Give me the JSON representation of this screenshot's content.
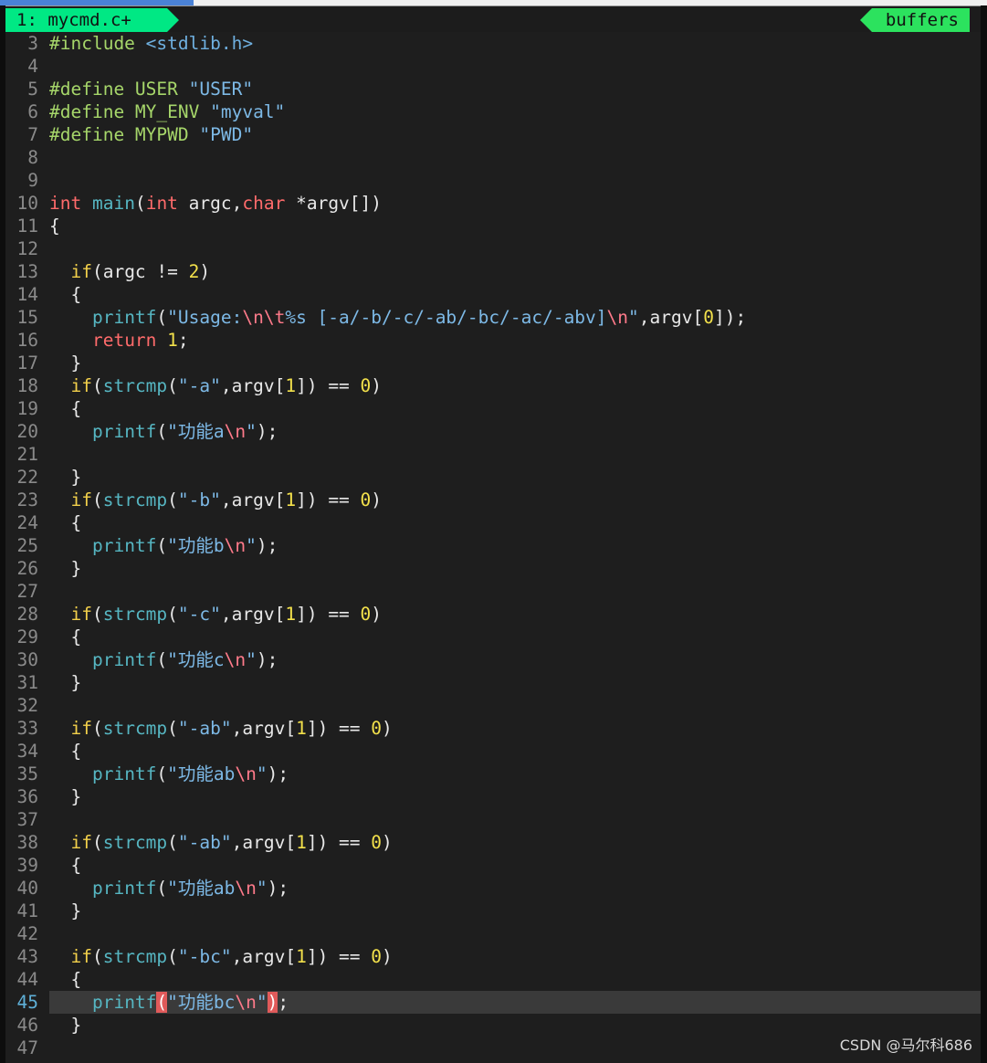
{
  "tabline": {
    "tab_label": "1: mycmd.c+",
    "buffers_label": "buffers"
  },
  "watermark": "CSDN @马尔科686",
  "lines": [
    {
      "n": "3",
      "tokens": [
        [
          "pre",
          "#include "
        ],
        [
          "inc",
          "<stdlib.h>"
        ]
      ]
    },
    {
      "n": "4",
      "tokens": []
    },
    {
      "n": "5",
      "tokens": [
        [
          "pre",
          "#define USER "
        ],
        [
          "str",
          "\"USER\""
        ]
      ]
    },
    {
      "n": "6",
      "tokens": [
        [
          "pre",
          "#define MY_ENV "
        ],
        [
          "str",
          "\"myval\""
        ]
      ]
    },
    {
      "n": "7",
      "tokens": [
        [
          "pre",
          "#define MYPWD "
        ],
        [
          "str",
          "\"PWD\""
        ]
      ]
    },
    {
      "n": "8",
      "tokens": []
    },
    {
      "n": "9",
      "tokens": []
    },
    {
      "n": "10",
      "tokens": [
        [
          "type",
          "int"
        ],
        [
          "plain",
          " "
        ],
        [
          "fn",
          "main"
        ],
        [
          "plain",
          "("
        ],
        [
          "type",
          "int"
        ],
        [
          "plain",
          " argc,"
        ],
        [
          "type",
          "char"
        ],
        [
          "plain",
          " *argv[])"
        ]
      ]
    },
    {
      "n": "11",
      "tokens": [
        [
          "plain",
          "{"
        ]
      ]
    },
    {
      "n": "12",
      "tokens": []
    },
    {
      "n": "13",
      "tokens": [
        [
          "plain",
          "  "
        ],
        [
          "kw",
          "if"
        ],
        [
          "plain",
          "(argc != "
        ],
        [
          "num",
          "2"
        ],
        [
          "plain",
          ")"
        ]
      ]
    },
    {
      "n": "14",
      "tokens": [
        [
          "plain",
          "  {"
        ]
      ]
    },
    {
      "n": "15",
      "tokens": [
        [
          "plain",
          "    "
        ],
        [
          "fn",
          "printf"
        ],
        [
          "plain",
          "("
        ],
        [
          "str",
          "\"Usage:"
        ],
        [
          "esc",
          "\\n\\t"
        ],
        [
          "str",
          "%s [-a/-b/-c/-ab/-bc/-ac/-abv]"
        ],
        [
          "esc",
          "\\n"
        ],
        [
          "str",
          "\""
        ],
        [
          "plain",
          ",argv["
        ],
        [
          "num",
          "0"
        ],
        [
          "plain",
          "]);"
        ]
      ]
    },
    {
      "n": "16",
      "tokens": [
        [
          "plain",
          "    "
        ],
        [
          "ret",
          "return"
        ],
        [
          "plain",
          " "
        ],
        [
          "num",
          "1"
        ],
        [
          "plain",
          ";"
        ]
      ]
    },
    {
      "n": "17",
      "tokens": [
        [
          "plain",
          "  }"
        ]
      ]
    },
    {
      "n": "18",
      "tokens": [
        [
          "plain",
          "  "
        ],
        [
          "kw",
          "if"
        ],
        [
          "plain",
          "("
        ],
        [
          "fn",
          "strcmp"
        ],
        [
          "plain",
          "("
        ],
        [
          "str",
          "\"-a\""
        ],
        [
          "plain",
          ",argv["
        ],
        [
          "num",
          "1"
        ],
        [
          "plain",
          "]) == "
        ],
        [
          "num",
          "0"
        ],
        [
          "plain",
          ")"
        ]
      ]
    },
    {
      "n": "19",
      "tokens": [
        [
          "plain",
          "  {"
        ]
      ]
    },
    {
      "n": "20",
      "tokens": [
        [
          "plain",
          "    "
        ],
        [
          "fn",
          "printf"
        ],
        [
          "plain",
          "("
        ],
        [
          "str",
          "\"功能a"
        ],
        [
          "esc",
          "\\n"
        ],
        [
          "str",
          "\""
        ],
        [
          "plain",
          ");"
        ]
      ]
    },
    {
      "n": "21",
      "tokens": []
    },
    {
      "n": "22",
      "tokens": [
        [
          "plain",
          "  }"
        ]
      ]
    },
    {
      "n": "23",
      "tokens": [
        [
          "plain",
          "  "
        ],
        [
          "kw",
          "if"
        ],
        [
          "plain",
          "("
        ],
        [
          "fn",
          "strcmp"
        ],
        [
          "plain",
          "("
        ],
        [
          "str",
          "\"-b\""
        ],
        [
          "plain",
          ",argv["
        ],
        [
          "num",
          "1"
        ],
        [
          "plain",
          "]) == "
        ],
        [
          "num",
          "0"
        ],
        [
          "plain",
          ")"
        ]
      ]
    },
    {
      "n": "24",
      "tokens": [
        [
          "plain",
          "  {"
        ]
      ]
    },
    {
      "n": "25",
      "tokens": [
        [
          "plain",
          "    "
        ],
        [
          "fn",
          "printf"
        ],
        [
          "plain",
          "("
        ],
        [
          "str",
          "\"功能b"
        ],
        [
          "esc",
          "\\n"
        ],
        [
          "str",
          "\""
        ],
        [
          "plain",
          ");"
        ]
      ]
    },
    {
      "n": "26",
      "tokens": [
        [
          "plain",
          "  }"
        ]
      ]
    },
    {
      "n": "27",
      "tokens": []
    },
    {
      "n": "28",
      "tokens": [
        [
          "plain",
          "  "
        ],
        [
          "kw",
          "if"
        ],
        [
          "plain",
          "("
        ],
        [
          "fn",
          "strcmp"
        ],
        [
          "plain",
          "("
        ],
        [
          "str",
          "\"-c\""
        ],
        [
          "plain",
          ",argv["
        ],
        [
          "num",
          "1"
        ],
        [
          "plain",
          "]) == "
        ],
        [
          "num",
          "0"
        ],
        [
          "plain",
          ")"
        ]
      ]
    },
    {
      "n": "29",
      "tokens": [
        [
          "plain",
          "  {"
        ]
      ]
    },
    {
      "n": "30",
      "tokens": [
        [
          "plain",
          "    "
        ],
        [
          "fn",
          "printf"
        ],
        [
          "plain",
          "("
        ],
        [
          "str",
          "\"功能c"
        ],
        [
          "esc",
          "\\n"
        ],
        [
          "str",
          "\""
        ],
        [
          "plain",
          ");"
        ]
      ]
    },
    {
      "n": "31",
      "tokens": [
        [
          "plain",
          "  }"
        ]
      ]
    },
    {
      "n": "32",
      "tokens": []
    },
    {
      "n": "33",
      "tokens": [
        [
          "plain",
          "  "
        ],
        [
          "kw",
          "if"
        ],
        [
          "plain",
          "("
        ],
        [
          "fn",
          "strcmp"
        ],
        [
          "plain",
          "("
        ],
        [
          "str",
          "\"-ab\""
        ],
        [
          "plain",
          ",argv["
        ],
        [
          "num",
          "1"
        ],
        [
          "plain",
          "]) == "
        ],
        [
          "num",
          "0"
        ],
        [
          "plain",
          ")"
        ]
      ]
    },
    {
      "n": "34",
      "tokens": [
        [
          "plain",
          "  {"
        ]
      ]
    },
    {
      "n": "35",
      "tokens": [
        [
          "plain",
          "    "
        ],
        [
          "fn",
          "printf"
        ],
        [
          "plain",
          "("
        ],
        [
          "str",
          "\"功能ab"
        ],
        [
          "esc",
          "\\n"
        ],
        [
          "str",
          "\""
        ],
        [
          "plain",
          ");"
        ]
      ]
    },
    {
      "n": "36",
      "tokens": [
        [
          "plain",
          "  }"
        ]
      ]
    },
    {
      "n": "37",
      "tokens": []
    },
    {
      "n": "38",
      "tokens": [
        [
          "plain",
          "  "
        ],
        [
          "kw",
          "if"
        ],
        [
          "plain",
          "("
        ],
        [
          "fn",
          "strcmp"
        ],
        [
          "plain",
          "("
        ],
        [
          "str",
          "\"-ab\""
        ],
        [
          "plain",
          ",argv["
        ],
        [
          "num",
          "1"
        ],
        [
          "plain",
          "]) == "
        ],
        [
          "num",
          "0"
        ],
        [
          "plain",
          ")"
        ]
      ]
    },
    {
      "n": "39",
      "tokens": [
        [
          "plain",
          "  {"
        ]
      ]
    },
    {
      "n": "40",
      "tokens": [
        [
          "plain",
          "    "
        ],
        [
          "fn",
          "printf"
        ],
        [
          "plain",
          "("
        ],
        [
          "str",
          "\"功能ab"
        ],
        [
          "esc",
          "\\n"
        ],
        [
          "str",
          "\""
        ],
        [
          "plain",
          ");"
        ]
      ]
    },
    {
      "n": "41",
      "tokens": [
        [
          "plain",
          "  }"
        ]
      ]
    },
    {
      "n": "42",
      "tokens": []
    },
    {
      "n": "43",
      "tokens": [
        [
          "plain",
          "  "
        ],
        [
          "kw",
          "if"
        ],
        [
          "plain",
          "("
        ],
        [
          "fn",
          "strcmp"
        ],
        [
          "plain",
          "("
        ],
        [
          "str",
          "\"-bc\""
        ],
        [
          "plain",
          ",argv["
        ],
        [
          "num",
          "1"
        ],
        [
          "plain",
          "]) == "
        ],
        [
          "num",
          "0"
        ],
        [
          "plain",
          ")"
        ]
      ]
    },
    {
      "n": "44",
      "tokens": [
        [
          "plain",
          "  {"
        ]
      ]
    },
    {
      "n": "45",
      "cursor": true,
      "tokens": [
        [
          "plain",
          "    "
        ],
        [
          "fn",
          "printf"
        ],
        [
          "paren",
          "("
        ],
        [
          "str",
          "\"功能bc"
        ],
        [
          "esc",
          "\\n"
        ],
        [
          "str",
          "\""
        ],
        [
          "paren",
          ")"
        ],
        [
          "plain",
          ";"
        ]
      ]
    },
    {
      "n": "46",
      "tokens": [
        [
          "plain",
          "  }"
        ]
      ]
    },
    {
      "n": "47",
      "tokens": []
    }
  ]
}
